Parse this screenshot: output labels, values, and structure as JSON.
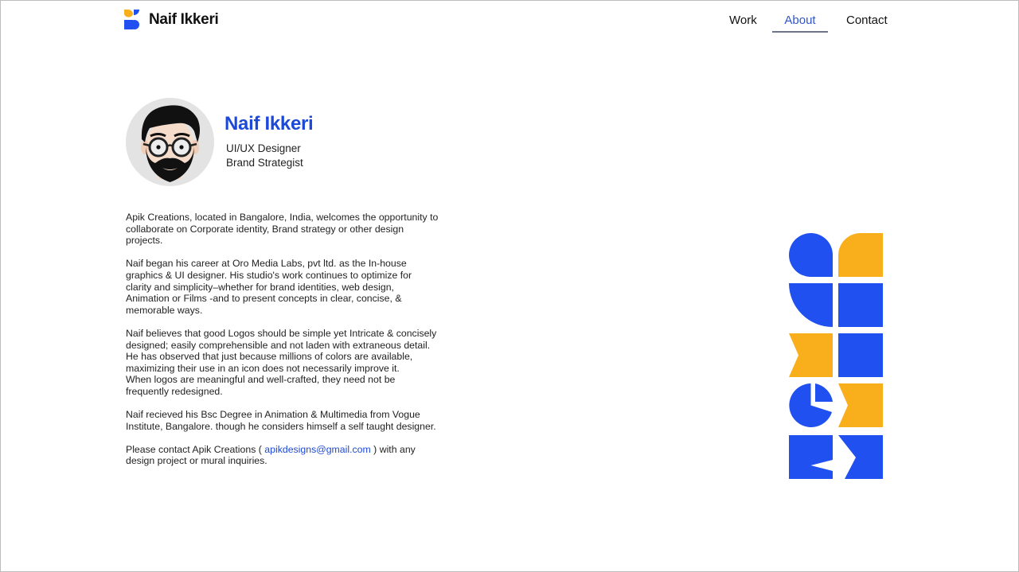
{
  "header": {
    "brand_name": "Naif Ikkeri",
    "nav": {
      "work": "Work",
      "about": "About",
      "contact": "Contact"
    },
    "active_item": "About"
  },
  "profile": {
    "name": "Naif Ikkeri",
    "roles": [
      "UI/UX Designer",
      "Brand Strategist"
    ]
  },
  "bio": {
    "p1": "Apik Creations, located in Bangalore, India, welcomes the opportunity to\ncollaborate on Corporate identity, Brand strategy or other design\nprojects.",
    "p2": "Naif began his career at Oro Media Labs, pvt ltd. as the In-house\ngraphics & UI designer. His studio's work continues to optimize for\nclarity and simplicity–whether for brand identities, web design,\nAnimation or Films -and to present concepts in clear, concise, &\nmemorable ways.",
    "p3": "Naif believes that good Logos should be simple yet Intricate & concisely\ndesigned; easily comprehensible and not laden with extraneous detail.\nHe has observed that just because millions of colors are available,\nmaximizing their use in an icon does not necessarily improve it.\nWhen logos are meaningful and well-crafted, they need not be\nfrequently redesigned.",
    "p4": "Naif recieved his Bsc Degree in Animation & Multimedia from Vogue\nInstitute, Bangalore. though he considers himself a self taught designer.",
    "p5_before": "Please contact Apik Creations ( ",
    "p5_email": "apikdesigns@gmail.com",
    "p5_after": " ) with any\ndesign project or mural inquiries."
  },
  "colors": {
    "brand_blue": "#1d49d8",
    "tile_blue": "#2050f0",
    "tile_yellow": "#f9ae1b",
    "active_nav": "#2f55c9"
  },
  "icons": [
    "logo-mark-icon",
    "avatar-illustration",
    "geometric-artwork"
  ]
}
